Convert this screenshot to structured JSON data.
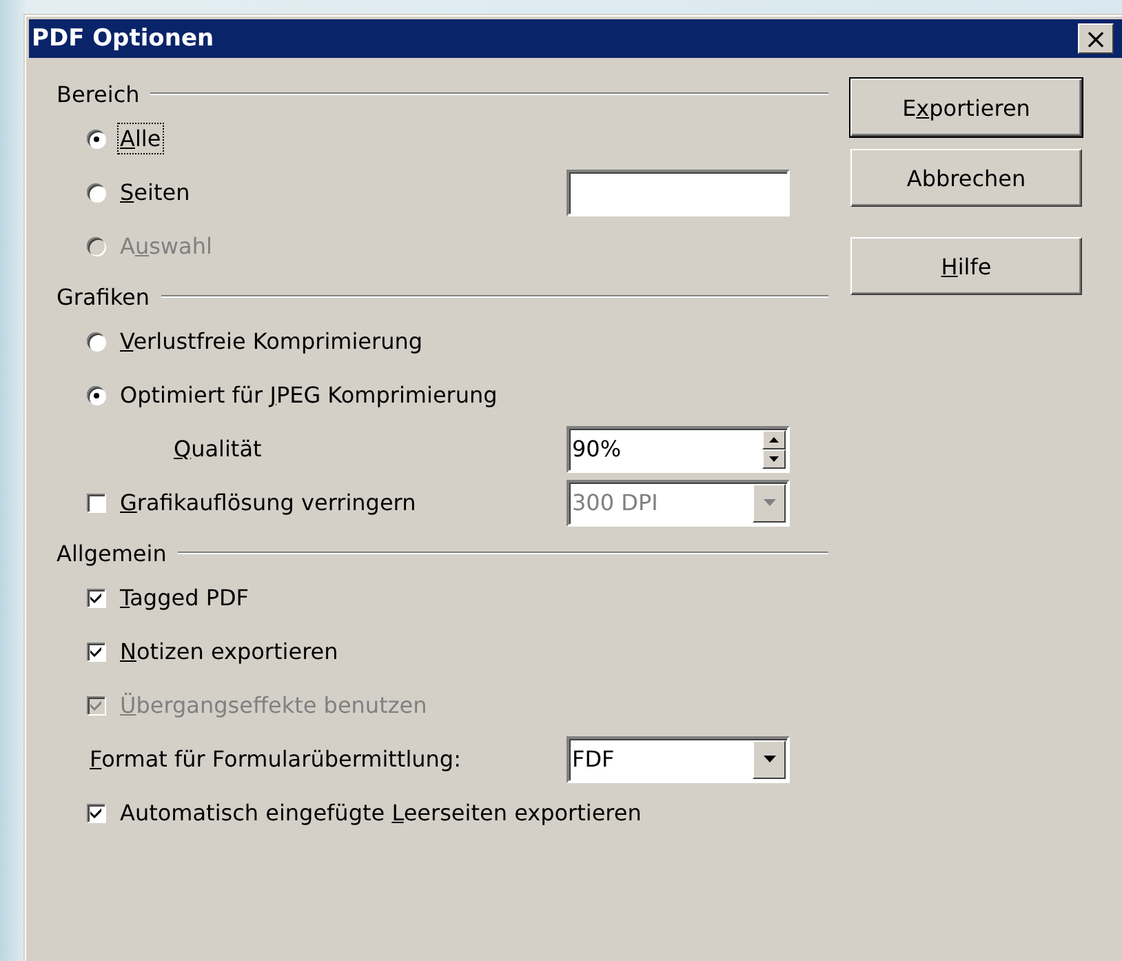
{
  "window": {
    "title": "PDF Optionen",
    "close": "×"
  },
  "buttons": [
    {
      "pre": "E",
      "key": "x",
      "post": "portieren",
      "default": true
    },
    {
      "post": "Abbrechen",
      "default": false
    },
    {
      "key": "H",
      "post": "ilfe",
      "default": false
    }
  ],
  "sections": [
    {
      "title": "Bereich",
      "items": [
        {
          "kind": "radio",
          "label": {
            "key": "A",
            "post": "lle"
          },
          "selected": true,
          "disabled": false,
          "focused": true
        },
        {
          "kind": "radio-field",
          "label": {
            "key": "S",
            "post": "eiten"
          },
          "selected": false,
          "disabled": false,
          "focused": false
        },
        {
          "kind": "radio",
          "label": {
            "pre": "A",
            "key": "u",
            "post": "swahl"
          },
          "selected": false,
          "disabled": true,
          "focused": false
        }
      ]
    },
    {
      "title": "Grafiken",
      "items": [
        {
          "kind": "radio",
          "label": {
            "key": "V",
            "post": "erlustfreie Komprimierung"
          },
          "selected": false,
          "disabled": false,
          "focused": false
        },
        {
          "kind": "radio",
          "label": {
            "pre": "Optimiert für ",
            "key": "J",
            "post": "PEG Komprimierung"
          },
          "selected": true,
          "disabled": false,
          "focused": false
        },
        {
          "kind": "spin",
          "label": {
            "key": "Q",
            "post": "ualität"
          },
          "value": "90%",
          "disabled": false
        },
        {
          "kind": "checkbox-dropdown",
          "label": {
            "key": "G",
            "post": "rafikauflösung verringern"
          },
          "checked": false,
          "disabled": false,
          "value": "300 DPI",
          "dropdown_disabled": true
        }
      ]
    },
    {
      "title": "Allgemein",
      "items": [
        {
          "kind": "checkbox",
          "label": {
            "key": "T",
            "post": "agged PDF"
          },
          "checked": true,
          "disabled": false
        },
        {
          "kind": "checkbox",
          "label": {
            "key": "N",
            "post": "otizen exportieren"
          },
          "checked": true,
          "disabled": false
        },
        {
          "kind": "checkbox",
          "label": {
            "key": "Ü",
            "post": "bergangseffekte benutzen"
          },
          "checked": true,
          "disabled": true
        },
        {
          "kind": "dropdown",
          "label": {
            "key": "F",
            "post": "ormat für Formularübermittlung:"
          },
          "value": "FDF",
          "disabled": false
        },
        {
          "kind": "checkbox",
          "label": {
            "pre": "Automatisch eingefügte ",
            "key": "L",
            "post": "eerseiten exportieren"
          },
          "checked": true,
          "disabled": false
        }
      ]
    }
  ]
}
